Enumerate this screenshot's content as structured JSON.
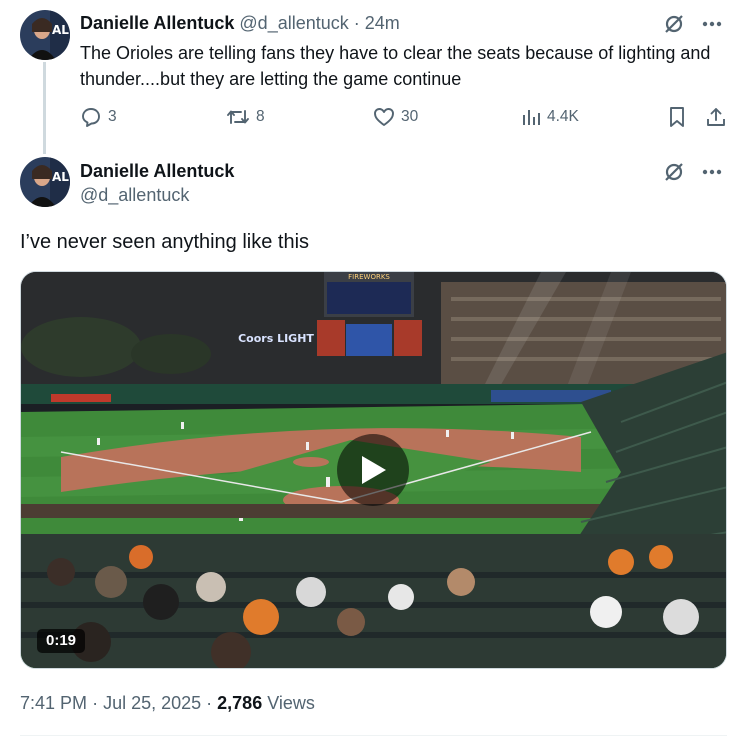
{
  "reply_tweet": {
    "author_name": "Danielle Allentuck",
    "handle": "@d_allentuck",
    "separator": "·",
    "time_ago": "24m",
    "text": "The Orioles are telling fans they have to clear the seats because of lighting and thunder....but they are letting the game continue",
    "replies": "3",
    "reposts": "8",
    "likes": "30",
    "views": "4.4K"
  },
  "main_tweet": {
    "author_name": "Danielle Allentuck",
    "handle": "@d_allentuck",
    "text": "I’ve never seen anything like this",
    "video_duration": "0:19",
    "stadium_sign_left": "Coors LIGHT",
    "stadium_sign_top": "FIREWORKS",
    "timestamp": "7:41 PM",
    "date": "Jul 25, 2025",
    "view_count": "2,786",
    "views_label": "Views"
  },
  "icons": {
    "grok": "grok-slash-icon",
    "more": "more-dots-icon",
    "reply": "reply-bubble-icon",
    "repost": "repost-arrows-icon",
    "like": "heart-icon",
    "views": "bar-chart-icon",
    "bookmark": "bookmark-icon",
    "share": "share-upload-icon",
    "play": "play-icon"
  },
  "colors": {
    "text_primary": "#0f1419",
    "text_secondary": "#536471",
    "border": "#cfd9de",
    "field_green": "#3f8a3a",
    "infield_dirt": "#b8735a"
  }
}
